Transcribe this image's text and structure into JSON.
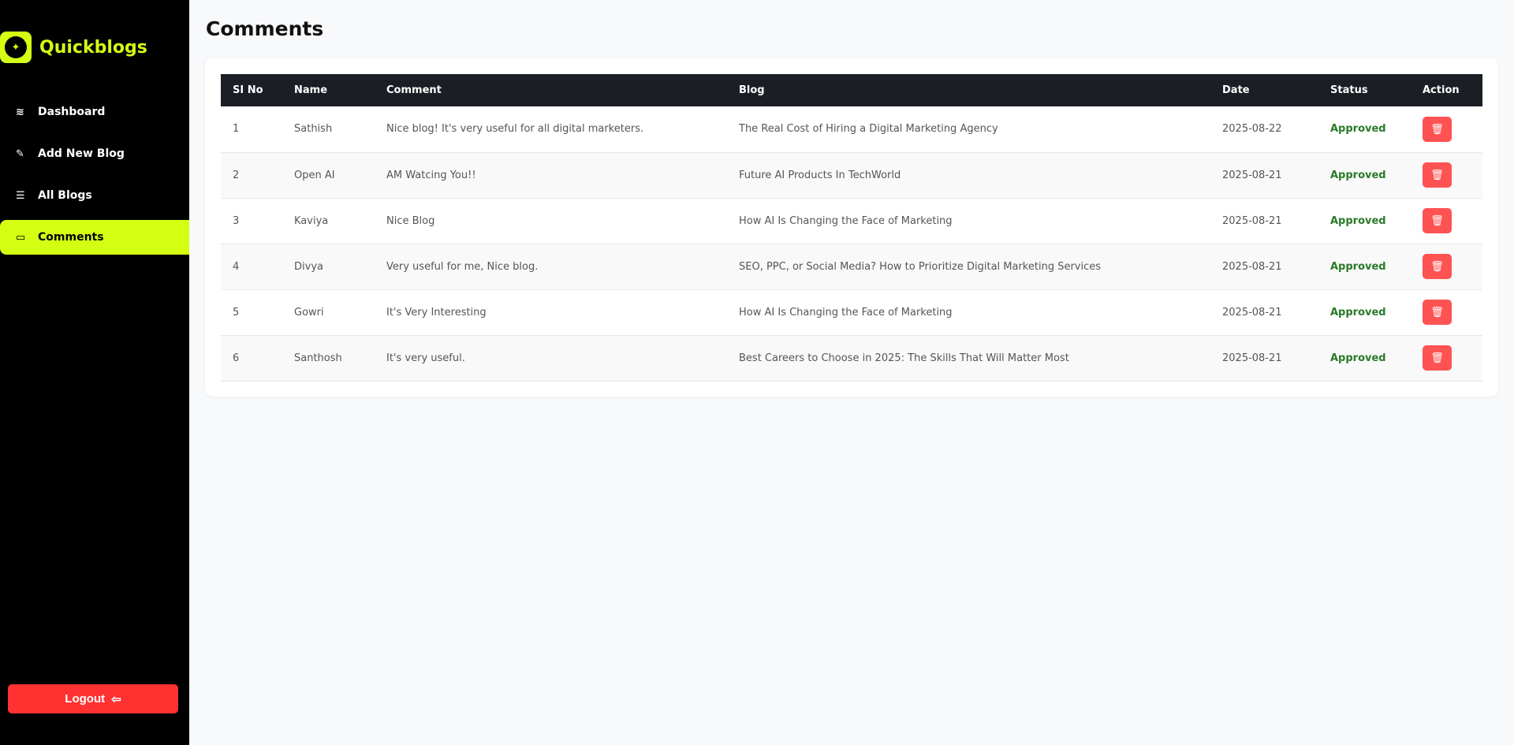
{
  "app": {
    "name": "Quickblogs"
  },
  "sidebar": {
    "items": [
      {
        "label": "Dashboard",
        "icon": "layers-icon",
        "glyph": "≋"
      },
      {
        "label": "Add New Blog",
        "icon": "edit-icon",
        "glyph": "✎"
      },
      {
        "label": "All Blogs",
        "icon": "list-icon",
        "glyph": "☰"
      },
      {
        "label": "Comments",
        "icon": "comment-icon",
        "glyph": "▭"
      }
    ],
    "logout": "Logout"
  },
  "page": {
    "title": "Comments"
  },
  "table": {
    "headers": [
      "SI No",
      "Name",
      "Comment",
      "Blog",
      "Date",
      "Status",
      "Action"
    ],
    "rows": [
      {
        "no": "1",
        "name": "Sathish",
        "comment": "Nice blog! It's very useful for all digital marketers.",
        "blog": "The Real Cost of Hiring a Digital Marketing Agency",
        "date": "2025-08-22",
        "status": "Approved"
      },
      {
        "no": "2",
        "name": "Open AI",
        "comment": "AM Watcing You!!",
        "blog": "Future AI Products In TechWorld",
        "date": "2025-08-21",
        "status": "Approved"
      },
      {
        "no": "3",
        "name": "Kaviya",
        "comment": "Nice Blog",
        "blog": "How AI Is Changing the Face of Marketing",
        "date": "2025-08-21",
        "status": "Approved"
      },
      {
        "no": "4",
        "name": "Divya",
        "comment": "Very useful for me, Nice blog.",
        "blog": "SEO, PPC, or Social Media? How to Prioritize Digital Marketing Services",
        "date": "2025-08-21",
        "status": "Approved"
      },
      {
        "no": "5",
        "name": "Gowri",
        "comment": "It's Very Interesting",
        "blog": "How AI Is Changing the Face of Marketing",
        "date": "2025-08-21",
        "status": "Approved"
      },
      {
        "no": "6",
        "name": "Santhosh",
        "comment": "It's very useful.",
        "blog": "Best Careers to Choose in 2025: The Skills That Will Matter Most",
        "date": "2025-08-21",
        "status": "Approved"
      }
    ]
  },
  "colors": {
    "accent": "#d4ff12",
    "danger": "#ff5252",
    "approved": "#2a7a2a"
  }
}
